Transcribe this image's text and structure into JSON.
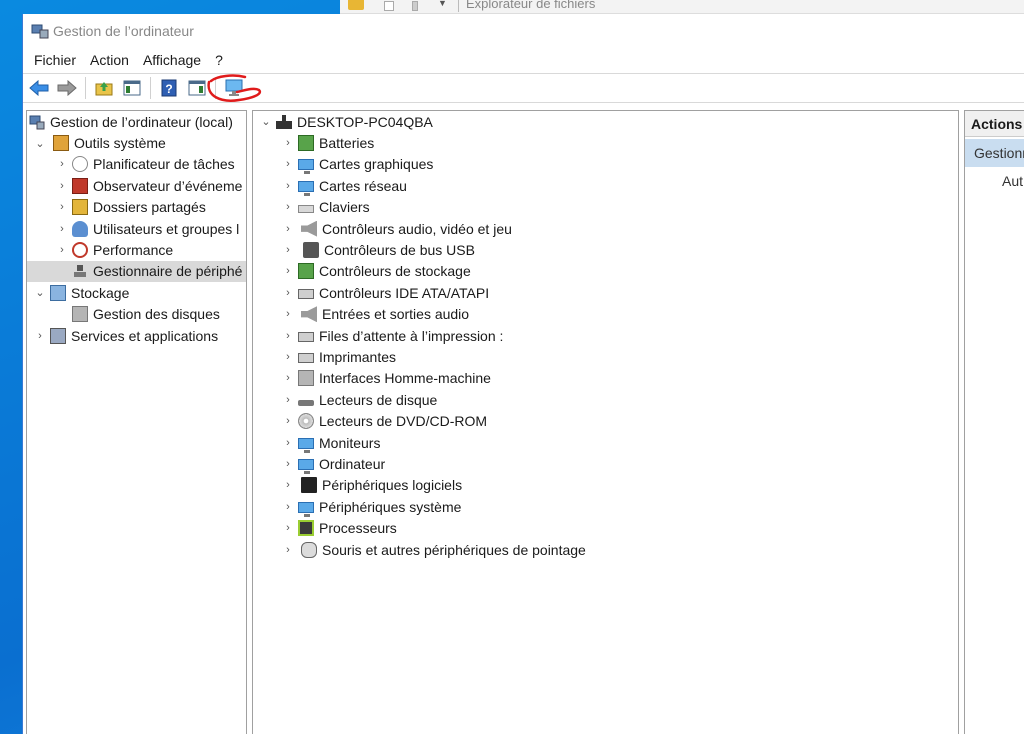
{
  "background_window": {
    "title": "Explorateur de fichiers"
  },
  "window": {
    "title": "Gestion de l’ordinateur"
  },
  "menu": [
    "Fichier",
    "Action",
    "Affichage",
    "?"
  ],
  "toolbar": {
    "buttons": [
      "back-arrow-icon",
      "forward-arrow-icon",
      "up-folder-icon",
      "show-hide-console-tree-icon",
      "help-icon",
      "show-hide-action-pane-icon",
      "scan-hardware-changes-icon"
    ],
    "annotation_color": "#e01b1b"
  },
  "tree": {
    "root": "Gestion de l’ordinateur (local)",
    "system_tools": "Outils système",
    "system_tools_children": [
      "Planificateur de tâches",
      "Observateur d’événeme",
      "Dossiers partagés",
      "Utilisateurs et groupes l",
      "Performance",
      "Gestionnaire de périphé"
    ],
    "storage": "Stockage",
    "storage_children": [
      "Gestion des disques"
    ],
    "services": "Services et applications"
  },
  "devices": {
    "computer_name": "DESKTOP-PC04QBA",
    "categories": [
      "Batteries",
      "Cartes graphiques",
      "Cartes réseau",
      "Claviers",
      "Contrôleurs audio, vidéo et jeu",
      "Contrôleurs de bus USB",
      "Contrôleurs de stockage",
      "Contrôleurs IDE ATA/ATAPI",
      "Entrées et sorties audio",
      "Files d’attente à l’impression :",
      "Imprimantes",
      "Interfaces Homme-machine",
      "Lecteurs de disque",
      "Lecteurs de DVD/CD-ROM",
      "Moniteurs",
      "Ordinateur",
      "Périphériques logiciels",
      "Périphériques système",
      "Processeurs",
      "Souris et autres périphériques de pointage"
    ]
  },
  "actions": {
    "header": "Actions",
    "selected": "Gestionn",
    "item": "Aut"
  }
}
